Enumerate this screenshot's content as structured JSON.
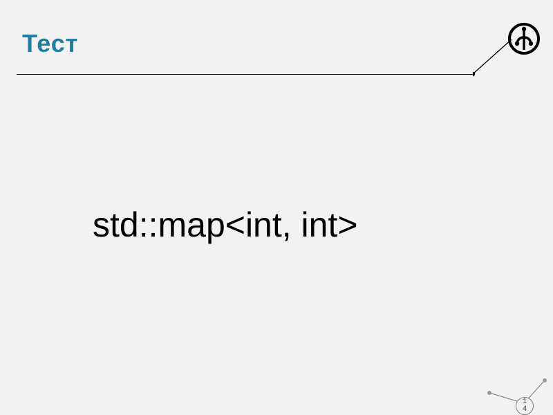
{
  "title": "Тест",
  "main_code": "std::map<int, int>",
  "page_number_line1": "1",
  "page_number_line2": "4",
  "colors": {
    "title": "#1f7ea1",
    "background": "#f2f2f2"
  },
  "icon_name": "tree-branch-icon"
}
